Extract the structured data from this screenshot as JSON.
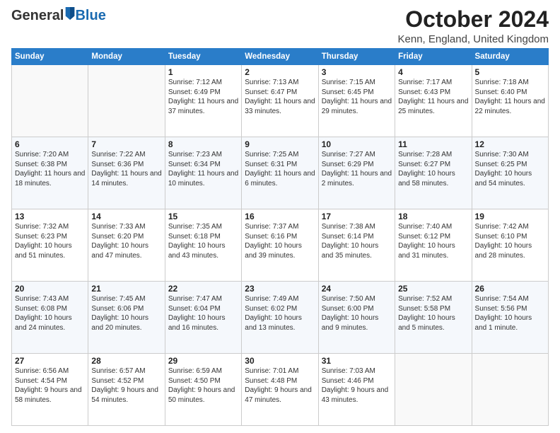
{
  "header": {
    "logo_general": "General",
    "logo_blue": "Blue",
    "month": "October 2024",
    "location": "Kenn, England, United Kingdom"
  },
  "weekdays": [
    "Sunday",
    "Monday",
    "Tuesday",
    "Wednesday",
    "Thursday",
    "Friday",
    "Saturday"
  ],
  "weeks": [
    [
      {
        "day": "",
        "info": ""
      },
      {
        "day": "",
        "info": ""
      },
      {
        "day": "1",
        "info": "Sunrise: 7:12 AM\nSunset: 6:49 PM\nDaylight: 11 hours and 37 minutes."
      },
      {
        "day": "2",
        "info": "Sunrise: 7:13 AM\nSunset: 6:47 PM\nDaylight: 11 hours and 33 minutes."
      },
      {
        "day": "3",
        "info": "Sunrise: 7:15 AM\nSunset: 6:45 PM\nDaylight: 11 hours and 29 minutes."
      },
      {
        "day": "4",
        "info": "Sunrise: 7:17 AM\nSunset: 6:43 PM\nDaylight: 11 hours and 25 minutes."
      },
      {
        "day": "5",
        "info": "Sunrise: 7:18 AM\nSunset: 6:40 PM\nDaylight: 11 hours and 22 minutes."
      }
    ],
    [
      {
        "day": "6",
        "info": "Sunrise: 7:20 AM\nSunset: 6:38 PM\nDaylight: 11 hours and 18 minutes."
      },
      {
        "day": "7",
        "info": "Sunrise: 7:22 AM\nSunset: 6:36 PM\nDaylight: 11 hours and 14 minutes."
      },
      {
        "day": "8",
        "info": "Sunrise: 7:23 AM\nSunset: 6:34 PM\nDaylight: 11 hours and 10 minutes."
      },
      {
        "day": "9",
        "info": "Sunrise: 7:25 AM\nSunset: 6:31 PM\nDaylight: 11 hours and 6 minutes."
      },
      {
        "day": "10",
        "info": "Sunrise: 7:27 AM\nSunset: 6:29 PM\nDaylight: 11 hours and 2 minutes."
      },
      {
        "day": "11",
        "info": "Sunrise: 7:28 AM\nSunset: 6:27 PM\nDaylight: 10 hours and 58 minutes."
      },
      {
        "day": "12",
        "info": "Sunrise: 7:30 AM\nSunset: 6:25 PM\nDaylight: 10 hours and 54 minutes."
      }
    ],
    [
      {
        "day": "13",
        "info": "Sunrise: 7:32 AM\nSunset: 6:23 PM\nDaylight: 10 hours and 51 minutes."
      },
      {
        "day": "14",
        "info": "Sunrise: 7:33 AM\nSunset: 6:20 PM\nDaylight: 10 hours and 47 minutes."
      },
      {
        "day": "15",
        "info": "Sunrise: 7:35 AM\nSunset: 6:18 PM\nDaylight: 10 hours and 43 minutes."
      },
      {
        "day": "16",
        "info": "Sunrise: 7:37 AM\nSunset: 6:16 PM\nDaylight: 10 hours and 39 minutes."
      },
      {
        "day": "17",
        "info": "Sunrise: 7:38 AM\nSunset: 6:14 PM\nDaylight: 10 hours and 35 minutes."
      },
      {
        "day": "18",
        "info": "Sunrise: 7:40 AM\nSunset: 6:12 PM\nDaylight: 10 hours and 31 minutes."
      },
      {
        "day": "19",
        "info": "Sunrise: 7:42 AM\nSunset: 6:10 PM\nDaylight: 10 hours and 28 minutes."
      }
    ],
    [
      {
        "day": "20",
        "info": "Sunrise: 7:43 AM\nSunset: 6:08 PM\nDaylight: 10 hours and 24 minutes."
      },
      {
        "day": "21",
        "info": "Sunrise: 7:45 AM\nSunset: 6:06 PM\nDaylight: 10 hours and 20 minutes."
      },
      {
        "day": "22",
        "info": "Sunrise: 7:47 AM\nSunset: 6:04 PM\nDaylight: 10 hours and 16 minutes."
      },
      {
        "day": "23",
        "info": "Sunrise: 7:49 AM\nSunset: 6:02 PM\nDaylight: 10 hours and 13 minutes."
      },
      {
        "day": "24",
        "info": "Sunrise: 7:50 AM\nSunset: 6:00 PM\nDaylight: 10 hours and 9 minutes."
      },
      {
        "day": "25",
        "info": "Sunrise: 7:52 AM\nSunset: 5:58 PM\nDaylight: 10 hours and 5 minutes."
      },
      {
        "day": "26",
        "info": "Sunrise: 7:54 AM\nSunset: 5:56 PM\nDaylight: 10 hours and 1 minute."
      }
    ],
    [
      {
        "day": "27",
        "info": "Sunrise: 6:56 AM\nSunset: 4:54 PM\nDaylight: 9 hours and 58 minutes."
      },
      {
        "day": "28",
        "info": "Sunrise: 6:57 AM\nSunset: 4:52 PM\nDaylight: 9 hours and 54 minutes."
      },
      {
        "day": "29",
        "info": "Sunrise: 6:59 AM\nSunset: 4:50 PM\nDaylight: 9 hours and 50 minutes."
      },
      {
        "day": "30",
        "info": "Sunrise: 7:01 AM\nSunset: 4:48 PM\nDaylight: 9 hours and 47 minutes."
      },
      {
        "day": "31",
        "info": "Sunrise: 7:03 AM\nSunset: 4:46 PM\nDaylight: 9 hours and 43 minutes."
      },
      {
        "day": "",
        "info": ""
      },
      {
        "day": "",
        "info": ""
      }
    ]
  ]
}
